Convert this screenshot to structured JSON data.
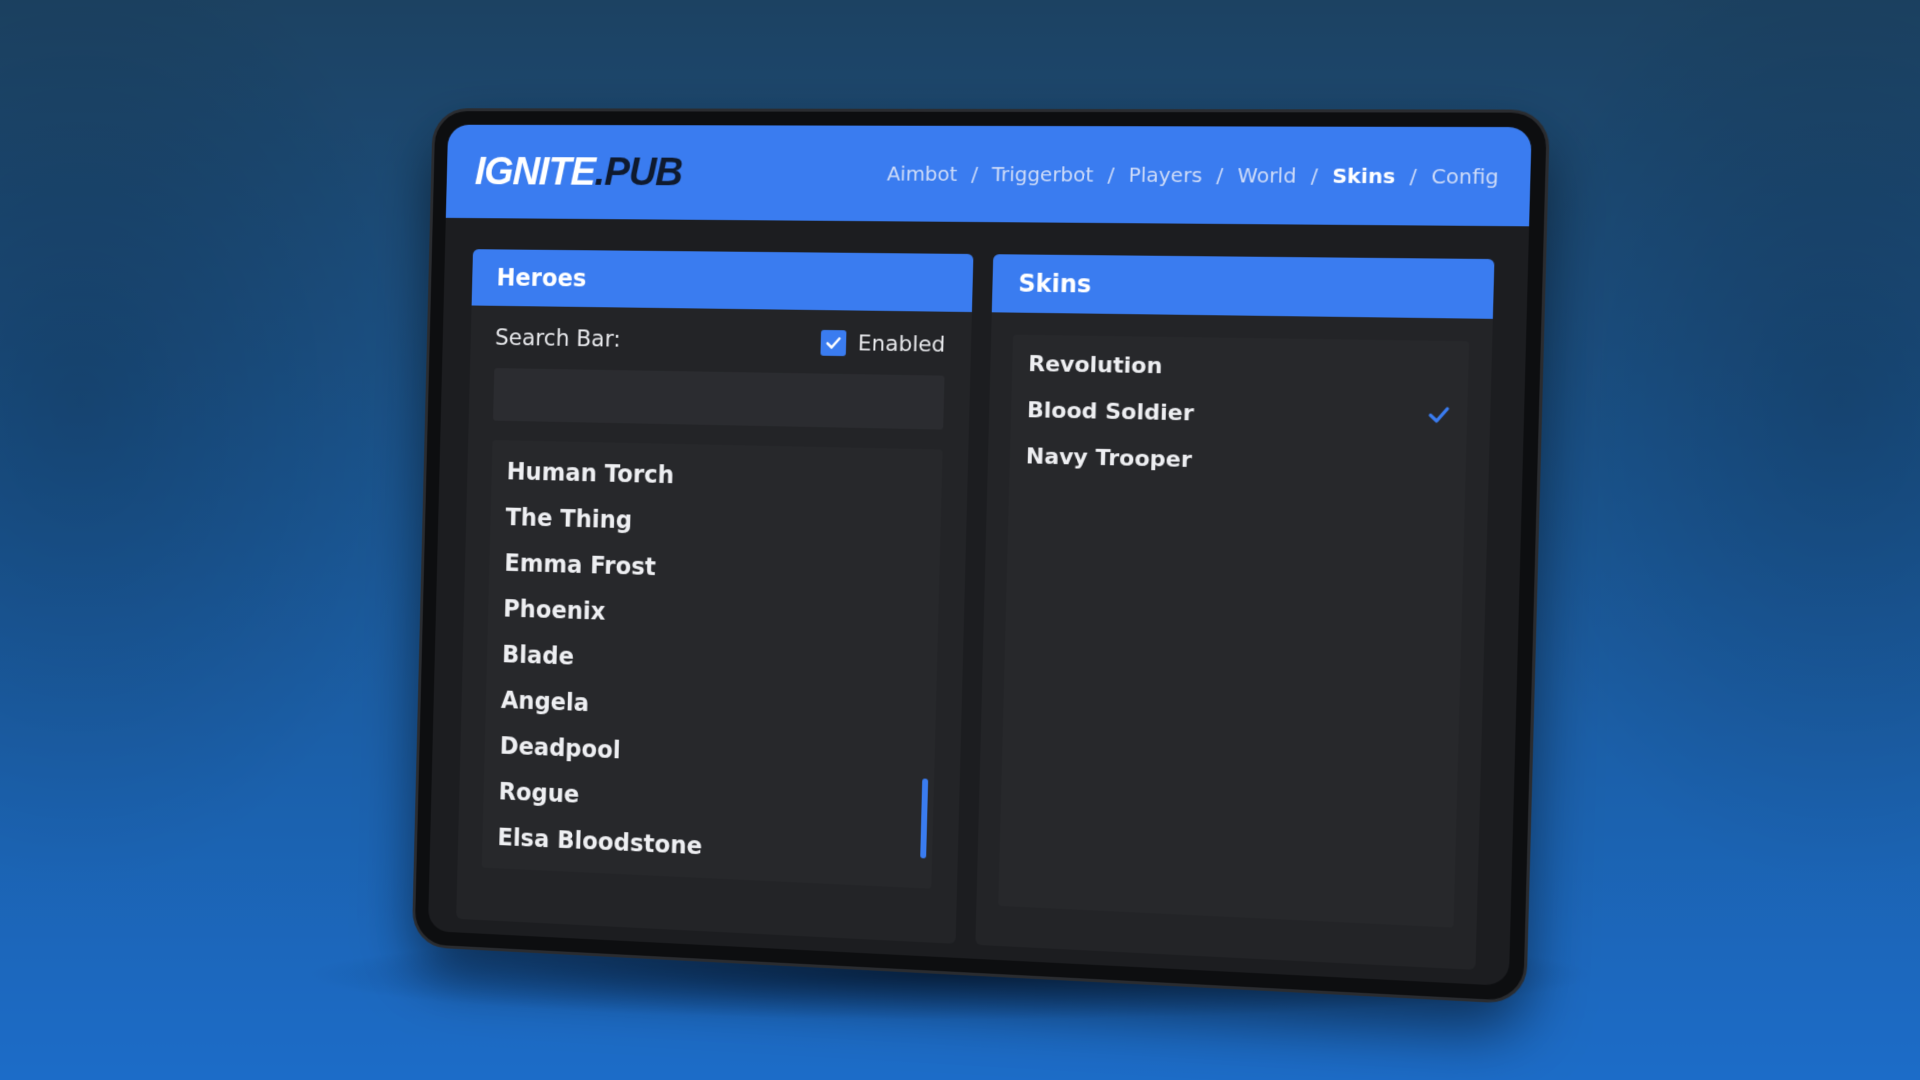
{
  "header": {
    "logo_main": "IGNITE",
    "logo_suffix": ".PUB",
    "nav": [
      {
        "label": "Aimbot",
        "active": false
      },
      {
        "label": "Triggerbot",
        "active": false
      },
      {
        "label": "Players",
        "active": false
      },
      {
        "label": "World",
        "active": false
      },
      {
        "label": "Skins",
        "active": true
      },
      {
        "label": "Config",
        "active": false
      }
    ],
    "separator": "/"
  },
  "heroes_panel": {
    "title": "Heroes",
    "search_label": "Search Bar:",
    "search_value": "",
    "enabled_label": "Enabled",
    "enabled_checked": true,
    "items": [
      "Human Torch",
      "The Thing",
      "Emma Frost",
      "Phoenix",
      "Blade",
      "Angela",
      "Deadpool",
      "Rogue",
      "Elsa Bloodstone"
    ]
  },
  "skins_panel": {
    "title": "Skins",
    "items": [
      {
        "label": "Revolution",
        "selected": false
      },
      {
        "label": "Blood Soldier",
        "selected": true
      },
      {
        "label": "Navy Trooper",
        "selected": false
      }
    ]
  },
  "colors": {
    "accent": "#3a7cf0",
    "panel": "#232427",
    "background_top": "#1c4262",
    "background_bottom": "#1c6cc8"
  },
  "icons": {
    "checkbox": "checkmark-icon",
    "selected_skin": "checkmark-icon"
  }
}
